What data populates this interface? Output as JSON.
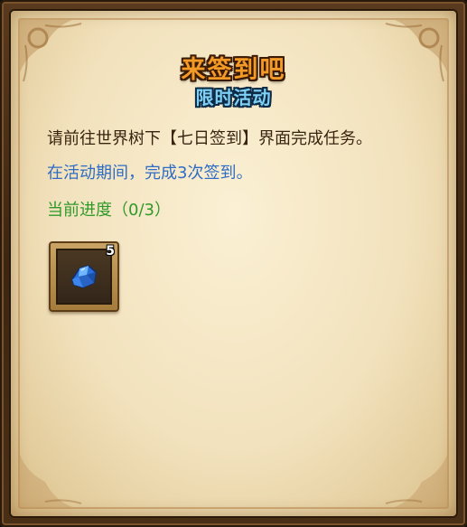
{
  "panel": {
    "title": "来签到吧",
    "subtitle": "限时活动",
    "description": "请前往世界树下【七日签到】界面完成任务。",
    "goal": "在活动期间，完成3次签到。",
    "progress": "当前进度（0/3）"
  },
  "reward": {
    "icon": "blue-crystal-icon",
    "count": "5"
  },
  "colors": {
    "title": "#f39a27",
    "subtitle": "#7fd0f5",
    "goal_text": "#2f6cc4",
    "progress_text": "#2f9a2a",
    "parchment": "#f2e2bd"
  }
}
